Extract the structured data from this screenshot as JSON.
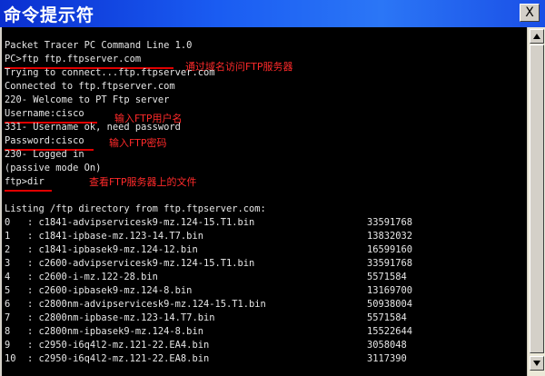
{
  "window": {
    "title": "命令提示符",
    "close_label": "X"
  },
  "console": {
    "header": "Packet Tracer PC Command Line 1.0",
    "cmd_ftp": "PC>ftp ftp.ftpserver.com",
    "trying": "Trying to connect...ftp.ftpserver.com",
    "connected": "Connected to ftp.ftpserver.com",
    "welcome": "220- Welcome to PT Ftp server",
    "username": "Username:cisco",
    "user_ok": "331- Username ok, need password",
    "password": "Password:cisco",
    "logged_in": "230- Logged in",
    "passive": "(passive mode On)",
    "cmd_dir": "ftp>dir",
    "listing": "Listing /ftp directory from ftp.ftpserver.com:",
    "files": [
      {
        "line": "0   : c1841-advipservicesk9-mz.124-15.T1.bin",
        "size": "33591768"
      },
      {
        "line": "1   : c1841-ipbase-mz.123-14.T7.bin",
        "size": "13832032"
      },
      {
        "line": "2   : c1841-ipbasek9-mz.124-12.bin",
        "size": "16599160"
      },
      {
        "line": "3   : c2600-advipservicesk9-mz.124-15.T1.bin",
        "size": "33591768"
      },
      {
        "line": "4   : c2600-i-mz.122-28.bin",
        "size": "5571584"
      },
      {
        "line": "5   : c2600-ipbasek9-mz.124-8.bin",
        "size": "13169700"
      },
      {
        "line": "6   : c2800nm-advipservicesk9-mz.124-15.T1.bin",
        "size": "50938004"
      },
      {
        "line": "7   : c2800nm-ipbase-mz.123-14.T7.bin",
        "size": "5571584"
      },
      {
        "line": "8   : c2800nm-ipbasek9-mz.124-8.bin",
        "size": "15522644"
      },
      {
        "line": "9   : c2950-i6q4l2-mz.121-22.EA4.bin",
        "size": "3058048"
      },
      {
        "line": "10  : c2950-i6q4l2-mz.121-22.EA8.bin",
        "size": "3117390"
      }
    ]
  },
  "annotations": {
    "ftp_domain": "通过域名访问FTP服务器",
    "username": "输入FTP用户名",
    "password": "输入FTP密码",
    "dir": "查看FTP服务器上的文件"
  },
  "colors": {
    "annotation": "#ff2a2a",
    "underline": "#e00000",
    "console_bg": "#000000",
    "console_text": "#e6e6e6"
  }
}
